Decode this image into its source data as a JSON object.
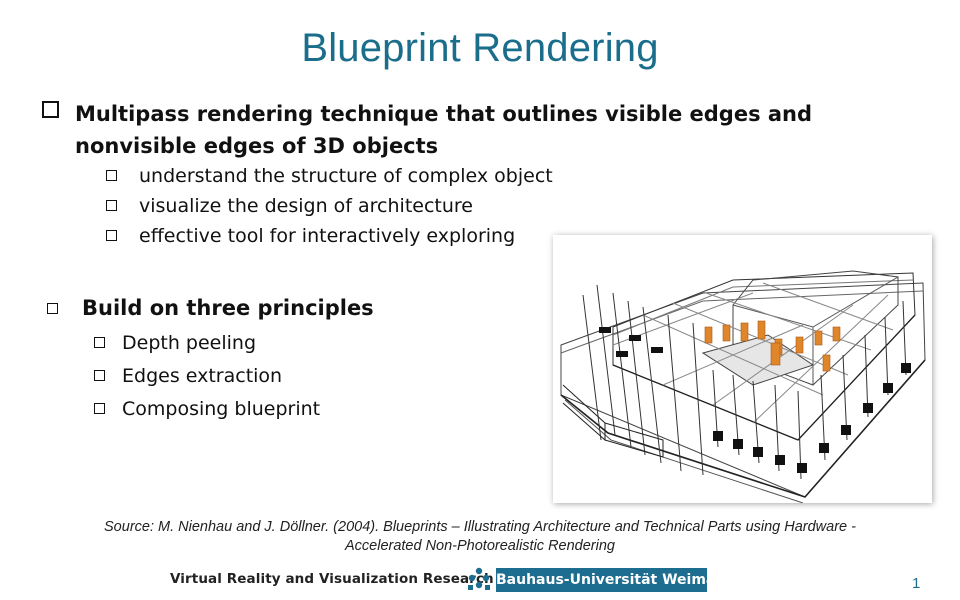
{
  "slide": {
    "title": "Blueprint Rendering",
    "bullets": [
      {
        "text": "Multipass rendering technique that outlines visible edges and nonvisible edges of 3D objects",
        "sub": [
          "understand the structure of complex object",
          "visualize the design of architecture",
          "effective tool for interactively exploring"
        ]
      },
      {
        "text": "Build on three principles",
        "sub": [
          "Depth peeling",
          "Edges extraction",
          "Composing blueprint"
        ]
      }
    ],
    "source_line1": "Source: M. Nienhau and J. Döllner. (2004). Blueprints – Illustrating Architecture and Technical Parts using Hardware -",
    "source_line2": "Accelerated Non-Photorealistic Rendering",
    "footer_text": "Virtual Reality and Visualization Research",
    "university": "Bauhaus-Universität Weimar",
    "page_number": "1",
    "colors": {
      "title": "#1a6e8c",
      "university_bg": "#1d6d91",
      "highlight_parts": "#e0862a"
    },
    "figure_icon": "blueprint-wireframe-building"
  }
}
